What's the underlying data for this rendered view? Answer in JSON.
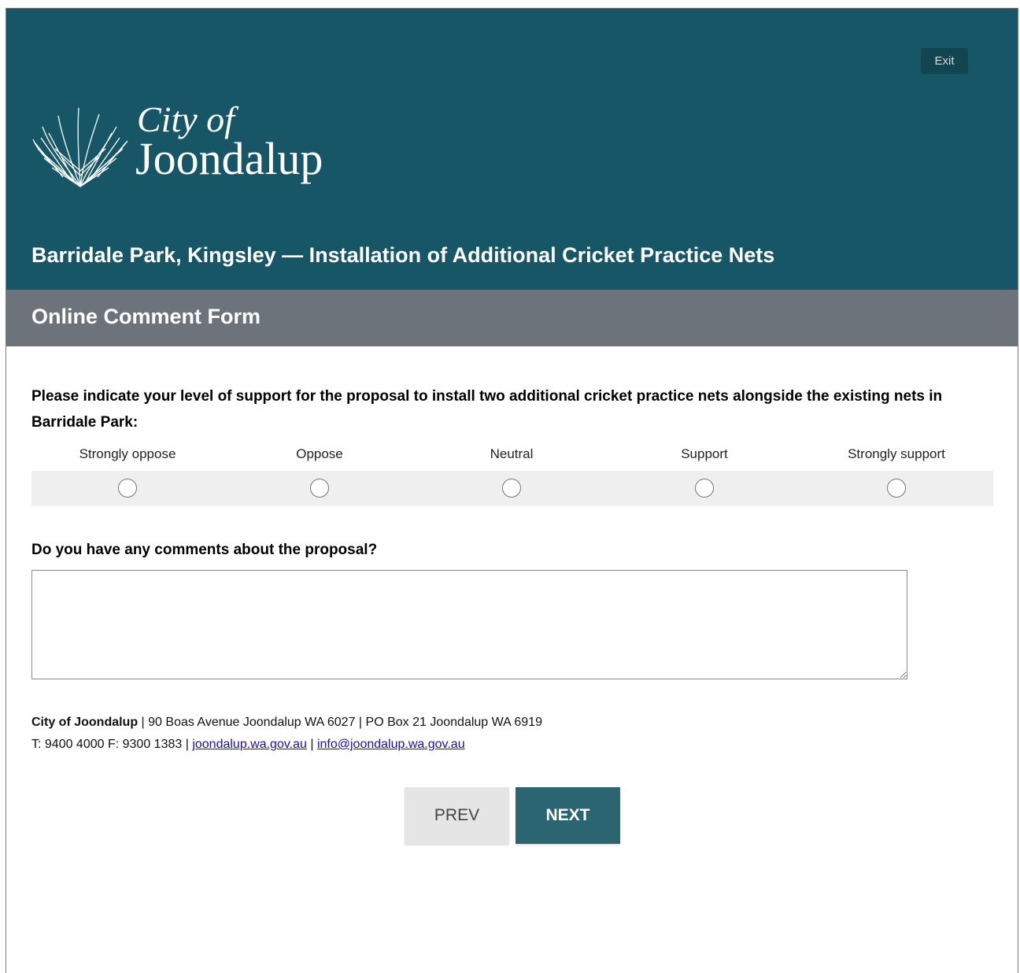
{
  "header": {
    "exit_label": "Exit",
    "logo_line1": "City of",
    "logo_line2": "Joondalup",
    "page_title": "Barridale Park, Kingsley — Installation of Additional Cricket Practice Nets",
    "form_title": "Online Comment Form"
  },
  "question1": {
    "text": "Please indicate your level of support for the proposal to install two additional cricket practice nets alongside the existing nets in Barridale Park:",
    "options": [
      "Strongly oppose",
      "Oppose",
      "Neutral",
      "Support",
      "Strongly support"
    ],
    "selected": null
  },
  "question2": {
    "text": "Do you have any comments about the proposal?",
    "value": ""
  },
  "footer": {
    "org_name": "City of Joondalup",
    "address": " | 90 Boas Avenue Joondalup WA 6027 | PO Box 21 Joondalup WA 6919",
    "phone_fax": "T: 9400 4000 F: 9300 1383 | ",
    "website": "joondalup.wa.gov.au",
    "separator": " | ",
    "email": "info@joondalup.wa.gov.au"
  },
  "nav": {
    "prev_label": "PREV",
    "next_label": "NEXT"
  },
  "colors": {
    "header_bg": "#175666",
    "subheader_bg": "#6d737a",
    "next_button_bg": "#2b6572",
    "prev_button_bg": "#e5e5e5"
  },
  "icons": {
    "logo": "palm-frond-logo-icon"
  }
}
